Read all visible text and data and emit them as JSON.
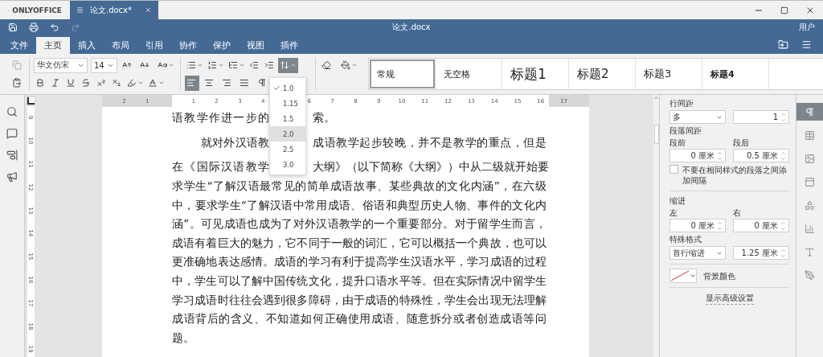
{
  "window": {
    "logo": "ONLYOFFICE",
    "tab": {
      "title": "论文.docx*",
      "active": true
    }
  },
  "header": {
    "title": "论文.docx",
    "user": "用户"
  },
  "menu_tabs": [
    {
      "label": "文件",
      "selected": false
    },
    {
      "label": "主页",
      "selected": true
    },
    {
      "label": "插入",
      "selected": false
    },
    {
      "label": "布局",
      "selected": false
    },
    {
      "label": "引用",
      "selected": false
    },
    {
      "label": "协作",
      "selected": false
    },
    {
      "label": "保护",
      "selected": false
    },
    {
      "label": "视图",
      "selected": false
    },
    {
      "label": "插件",
      "selected": false
    }
  ],
  "toolbar": {
    "font_name": "华文仿宋",
    "font_size": "14",
    "copy_disabled": true,
    "line_spacing_open": true,
    "alignment": [
      {
        "selected": true
      },
      {
        "selected": false
      },
      {
        "selected": false
      },
      {
        "selected": false
      }
    ]
  },
  "line_spacing_menu": [
    {
      "label": "1.0",
      "checked": true,
      "selected": false
    },
    {
      "label": "1.15",
      "checked": false,
      "selected": false
    },
    {
      "label": "1.5",
      "checked": false,
      "selected": false
    },
    {
      "label": "2.0",
      "checked": false,
      "selected": true
    },
    {
      "label": "2.5",
      "checked": false,
      "selected": false
    },
    {
      "label": "3.0",
      "checked": false,
      "selected": false
    }
  ],
  "styles": [
    {
      "label": "常规",
      "kind": "normal",
      "selected": true
    },
    {
      "label": "无空格",
      "kind": "normal",
      "selected": false
    },
    {
      "label": "标题1",
      "kind": "heading1",
      "selected": false
    },
    {
      "label": "标题2",
      "kind": "heading2",
      "selected": false
    },
    {
      "label": "标题3",
      "kind": "heading3",
      "selected": false
    },
    {
      "label": "标题4",
      "kind": "heading4",
      "selected": false
    }
  ],
  "rulers": {
    "horizontal": [
      "2",
      "1",
      "1",
      "2",
      "3",
      "4",
      "6",
      "7",
      "8",
      "9",
      "10",
      "11",
      "12",
      "13",
      "14",
      "15",
      "16",
      "17"
    ],
    "vertical": [
      "9",
      "10",
      "11",
      "12",
      "13",
      "14",
      "15",
      "16",
      "17",
      "18",
      "19"
    ]
  },
  "document": {
    "lines": [
      {
        "segments": [
          "语教学作进一步的",
          "索。"
        ],
        "indent": false,
        "kind": "end"
      },
      {
        "segments": [
          "就对外汉语教",
          "成语教学起步较晚，并不是教学的重点，但是"
        ],
        "indent": true,
        "kind": "full"
      },
      {
        "segments": [
          "在《国际汉语教学",
          "大纲》（以下简称《大纲》）中从二级就开始要"
        ],
        "indent": false,
        "kind": "full"
      },
      {
        "text": "求学生“了解汉语最常见的简单成语故事、某些典故的文化内涵”，在六级",
        "indent": false,
        "kind": "full"
      },
      {
        "text": "中，要求学生“了解汉语中常用成语、俗语和典型历史人物、事件的文化内",
        "indent": false,
        "kind": "full"
      },
      {
        "text": "涵”。可见成语也成为了对外汉语教学的一个重要部分。对于留学生而言，",
        "indent": false,
        "kind": "full"
      },
      {
        "text": "成语有着巨大的魅力，它不同于一般的词汇，它可以概括一个典故，也可以",
        "indent": false,
        "kind": "full"
      },
      {
        "text": "更准确地表达感情。成语的学习有利于提高学生汉语水平，学习成语的过程",
        "indent": false,
        "kind": "full"
      },
      {
        "text": "中，学生可以了解中国传统文化，提升口语水平等。但在实际情况中留学生",
        "indent": false,
        "kind": "full"
      },
      {
        "text": "学习成语时往往会遇到很多障碍，由于成语的特殊性，学生会出现无法理解",
        "indent": false,
        "kind": "full"
      },
      {
        "text": "成语背后的含义、不知道如何正确使用成语、随意拆分或者创造成语等问",
        "indent": false,
        "kind": "full"
      },
      {
        "text": "题。",
        "indent": false,
        "kind": "end"
      }
    ]
  },
  "paragraph_settings": {
    "line_spacing_label": "行间距",
    "line_spacing_rule": "多",
    "line_spacing_value": "1",
    "spacing_label": "段落间距",
    "before_label": "段前",
    "before_value": "0 厘米",
    "after_label": "段后",
    "after_value": "0.5 厘米",
    "no_space_checkbox": {
      "label": "不要在相同样式的段落之间添加间隔",
      "checked": false
    },
    "indent_label": "缩进",
    "left_label": "左",
    "left_value": "0 厘米",
    "right_label": "右",
    "right_value": "0 厘米",
    "special_label": "特殊格式",
    "special_value": "首行缩进",
    "special_amount": "1.25 厘米",
    "background_label": "背景颜色",
    "advanced_link": "显示高级设置"
  },
  "right_toolbar": [
    {
      "selected": true
    },
    {
      "selected": false
    },
    {
      "selected": false
    },
    {
      "selected": false
    },
    {
      "selected": false
    },
    {
      "selected": false
    },
    {
      "selected": false
    },
    {
      "selected": false
    }
  ]
}
